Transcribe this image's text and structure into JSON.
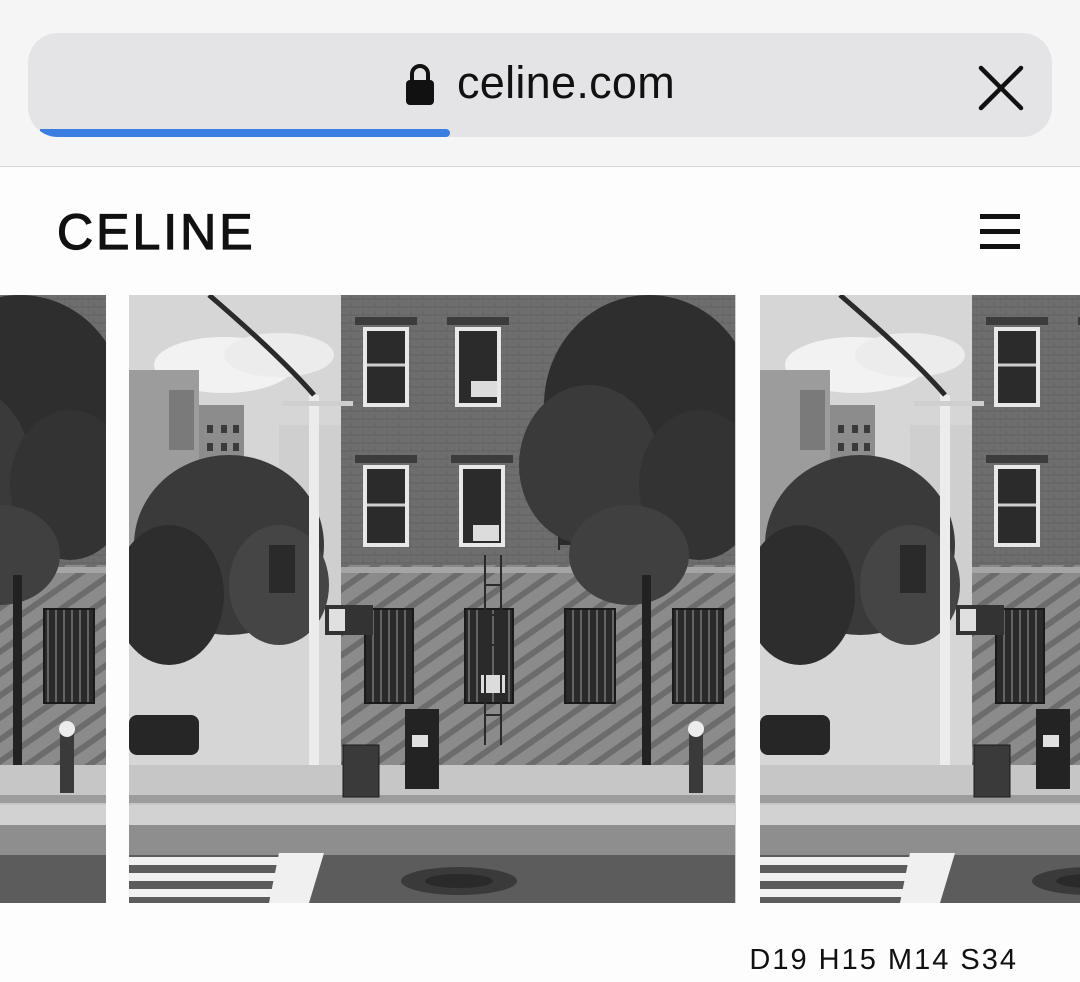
{
  "browser": {
    "url": "celine.com",
    "load_progress_percent": 40,
    "icons": [
      "lock-icon",
      "close-icon"
    ]
  },
  "site": {
    "brand": "CELINE",
    "menu_icon": "hamburger-menu-icon"
  },
  "carousel": {
    "slides": [
      {
        "image": "street-scene-bw",
        "state": "previous"
      },
      {
        "image": "street-scene-bw",
        "state": "current"
      },
      {
        "image": "street-scene-bw",
        "state": "next"
      }
    ]
  },
  "countdown": {
    "text": "D19 H15 M14 S34"
  },
  "colors": {
    "progress": "#3b7ee1",
    "chrome_bg": "#f5f5f6",
    "urlbar_bg": "#e4e4e6",
    "text": "#111111"
  }
}
